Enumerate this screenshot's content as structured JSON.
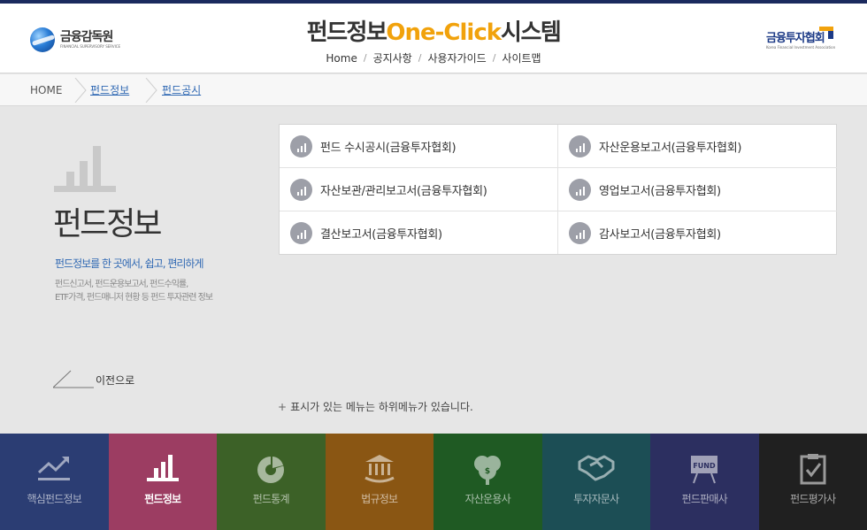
{
  "header": {
    "left_logo": {
      "name": "금융감독원",
      "sub": "FINANCIAL SUPERVISORY SERVICE"
    },
    "title_prefix": "펀드정보",
    "title_accent": "One-Click",
    "title_suffix": "시스템",
    "nav": [
      "Home",
      "공지사항",
      "사용자가이드",
      "사이트맵"
    ],
    "right_logo": {
      "name": "금융투자협회",
      "sub": "Korea Financial Investment Association"
    }
  },
  "breadcrumb": {
    "home": "HOME",
    "level1": "펀드정보",
    "level2": "펀드공시"
  },
  "panel": {
    "title": "펀드정보",
    "tagline": "펀드정보를 한 곳에서, 쉽고, 편리하게",
    "desc_line1": "펀드신고서, 펀드운용보고서, 펀드수익률,",
    "desc_line2": "ETF가격, 펀드매니저 현황 등 펀드 투자관련 정보",
    "back": "이전으로"
  },
  "menu_items": [
    "펀드 수시공시(금융투자협회)",
    "자산운용보고서(금융투자협회)",
    "자산보관/관리보고서(금융투자협회)",
    "영업보고서(금융투자협회)",
    "결산보고서(금융투자협회)",
    "감사보고서(금융투자협회)"
  ],
  "notice": {
    "plus": "+",
    "text": "표시가 있는 메뉴는 하위메뉴가 있습니다."
  },
  "tiles": [
    {
      "label": "핵심펀드정보",
      "color": "#2b3d73",
      "icon": "trend-up-icon"
    },
    {
      "label": "펀드정보",
      "color": "#9c3d62",
      "icon": "bar-chart-icon"
    },
    {
      "label": "펀드통계",
      "color": "#3c6127",
      "icon": "pie-chart-icon"
    },
    {
      "label": "법규정보",
      "color": "#8a5613",
      "icon": "building-icon"
    },
    {
      "label": "자산운용사",
      "color": "#1f5a23",
      "icon": "money-tree-icon"
    },
    {
      "label": "투자자문사",
      "color": "#1c4e55",
      "icon": "handshake-icon"
    },
    {
      "label": "펀드판매사",
      "color": "#2c2f60",
      "icon": "fund-board-icon"
    },
    {
      "label": "펀드평가사",
      "color": "#202020",
      "icon": "clipboard-check-icon"
    }
  ],
  "colors": {
    "accent": "#f1a20c",
    "link": "#2f68b3",
    "topline": "#1b2a5e"
  }
}
